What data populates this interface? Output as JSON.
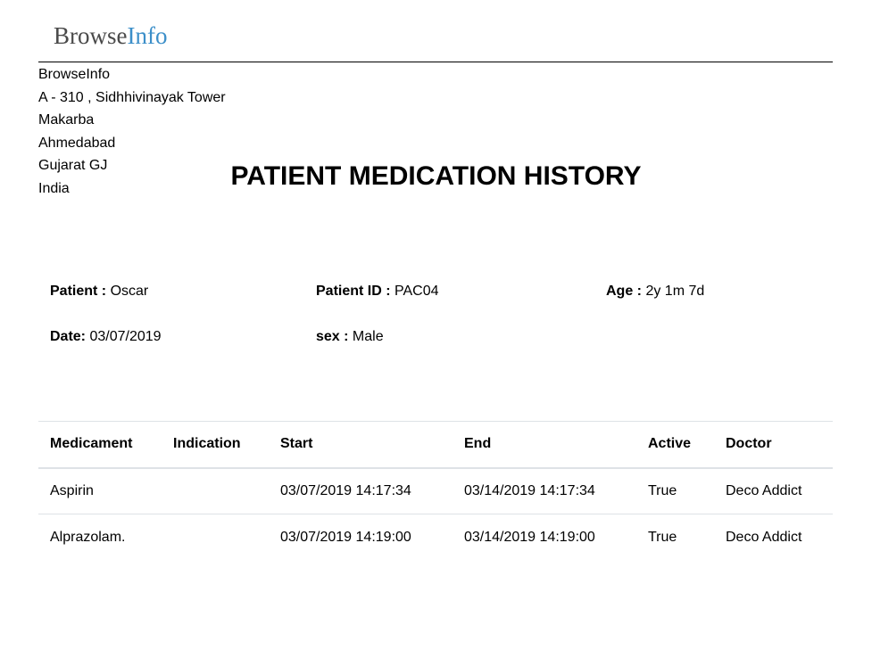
{
  "logo": {
    "part1": "Browse",
    "part2": "Info"
  },
  "company": {
    "name": "BrowseInfo",
    "address_line1": "A - 310 , Sidhhivinayak Tower",
    "address_line2": "Makarba",
    "city": "Ahmedabad",
    "state": "Gujarat GJ",
    "country": "India"
  },
  "report": {
    "title": "PATIENT MEDICATION HISTORY"
  },
  "patient": {
    "name_label": "Patient :",
    "name_value": "Oscar",
    "id_label": "Patient ID :",
    "id_value": "PAC04",
    "age_label": "Age :",
    "age_value": "2y 1m 7d",
    "date_label": "Date:",
    "date_value": "03/07/2019",
    "sex_label": "sex :",
    "sex_value": "Male"
  },
  "table": {
    "headers": [
      "Medicament",
      "Indication",
      "Start",
      "End",
      "Active",
      "Doctor"
    ],
    "rows": [
      [
        "Aspirin",
        "",
        "03/07/2019 14:17:34",
        "03/14/2019 14:17:34",
        "True",
        "Deco Addict"
      ],
      [
        "Alprazolam.",
        "",
        "03/07/2019 14:19:00",
        "03/14/2019 14:19:00",
        "True",
        "Deco Addict"
      ]
    ]
  },
  "colors": {
    "logo_info": "#3c8fc9",
    "logo_browse": "#4a4a4a",
    "table_border": "#dee2e6"
  }
}
